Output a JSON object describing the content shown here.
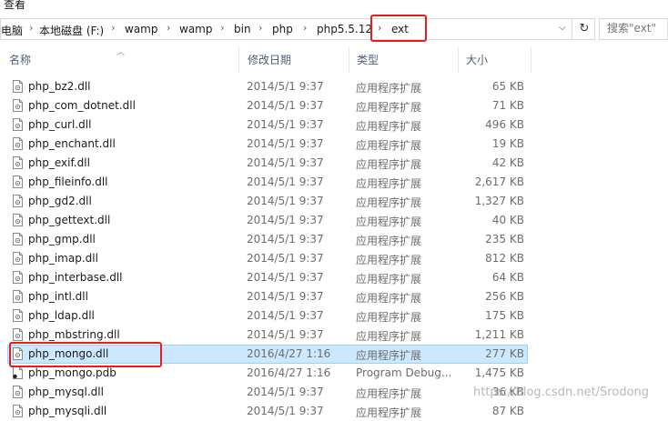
{
  "menu": {
    "view_label": "查看"
  },
  "breadcrumb": {
    "items": [
      "电脑",
      "本地磁盘 (F:)",
      "wamp",
      "wamp",
      "bin",
      "php",
      "php5.5.12",
      "ext"
    ]
  },
  "search": {
    "placeholder": "搜索\"ext\""
  },
  "columns": {
    "name": "名称",
    "date": "修改日期",
    "type": "类型",
    "size": "大小"
  },
  "files": [
    {
      "name": "php_bz2.dll",
      "date": "2014/5/1 9:37",
      "type": "应用程序扩展",
      "size": "65 KB"
    },
    {
      "name": "php_com_dotnet.dll",
      "date": "2014/5/1 9:37",
      "type": "应用程序扩展",
      "size": "71 KB"
    },
    {
      "name": "php_curl.dll",
      "date": "2014/5/1 9:37",
      "type": "应用程序扩展",
      "size": "496 KB"
    },
    {
      "name": "php_enchant.dll",
      "date": "2014/5/1 9:37",
      "type": "应用程序扩展",
      "size": "19 KB"
    },
    {
      "name": "php_exif.dll",
      "date": "2014/5/1 9:37",
      "type": "应用程序扩展",
      "size": "42 KB"
    },
    {
      "name": "php_fileinfo.dll",
      "date": "2014/5/1 9:37",
      "type": "应用程序扩展",
      "size": "2,617 KB"
    },
    {
      "name": "php_gd2.dll",
      "date": "2014/5/1 9:37",
      "type": "应用程序扩展",
      "size": "1,327 KB"
    },
    {
      "name": "php_gettext.dll",
      "date": "2014/5/1 9:37",
      "type": "应用程序扩展",
      "size": "40 KB"
    },
    {
      "name": "php_gmp.dll",
      "date": "2014/5/1 9:37",
      "type": "应用程序扩展",
      "size": "235 KB"
    },
    {
      "name": "php_imap.dll",
      "date": "2014/5/1 9:37",
      "type": "应用程序扩展",
      "size": "812 KB"
    },
    {
      "name": "php_interbase.dll",
      "date": "2014/5/1 9:37",
      "type": "应用程序扩展",
      "size": "64 KB"
    },
    {
      "name": "php_intl.dll",
      "date": "2014/5/1 9:37",
      "type": "应用程序扩展",
      "size": "256 KB"
    },
    {
      "name": "php_ldap.dll",
      "date": "2014/5/1 9:37",
      "type": "应用程序扩展",
      "size": "175 KB"
    },
    {
      "name": "php_mbstring.dll",
      "date": "2014/5/1 9:37",
      "type": "应用程序扩展",
      "size": "1,211 KB"
    },
    {
      "name": "php_mongo.dll",
      "date": "2016/4/27 1:16",
      "type": "应用程序扩展",
      "size": "277 KB"
    },
    {
      "name": "php_mongo.pdb",
      "date": "2016/4/27 1:16",
      "type": "Program Debug...",
      "size": "1,475 KB"
    },
    {
      "name": "php_mysql.dll",
      "date": "2014/5/1 9:37",
      "type": "应用程序扩展",
      "size": "36 KB"
    },
    {
      "name": "php_mysqli.dll",
      "date": "2014/5/1 9:37",
      "type": "应用程序扩展",
      "size": "87 KB"
    }
  ],
  "selected_file": "php_mongo.dll",
  "watermark": "https://blog.csdn.net/Srodong",
  "colors": {
    "selection_bg": "#cce8ff",
    "highlight_border": "#e51d1d"
  }
}
